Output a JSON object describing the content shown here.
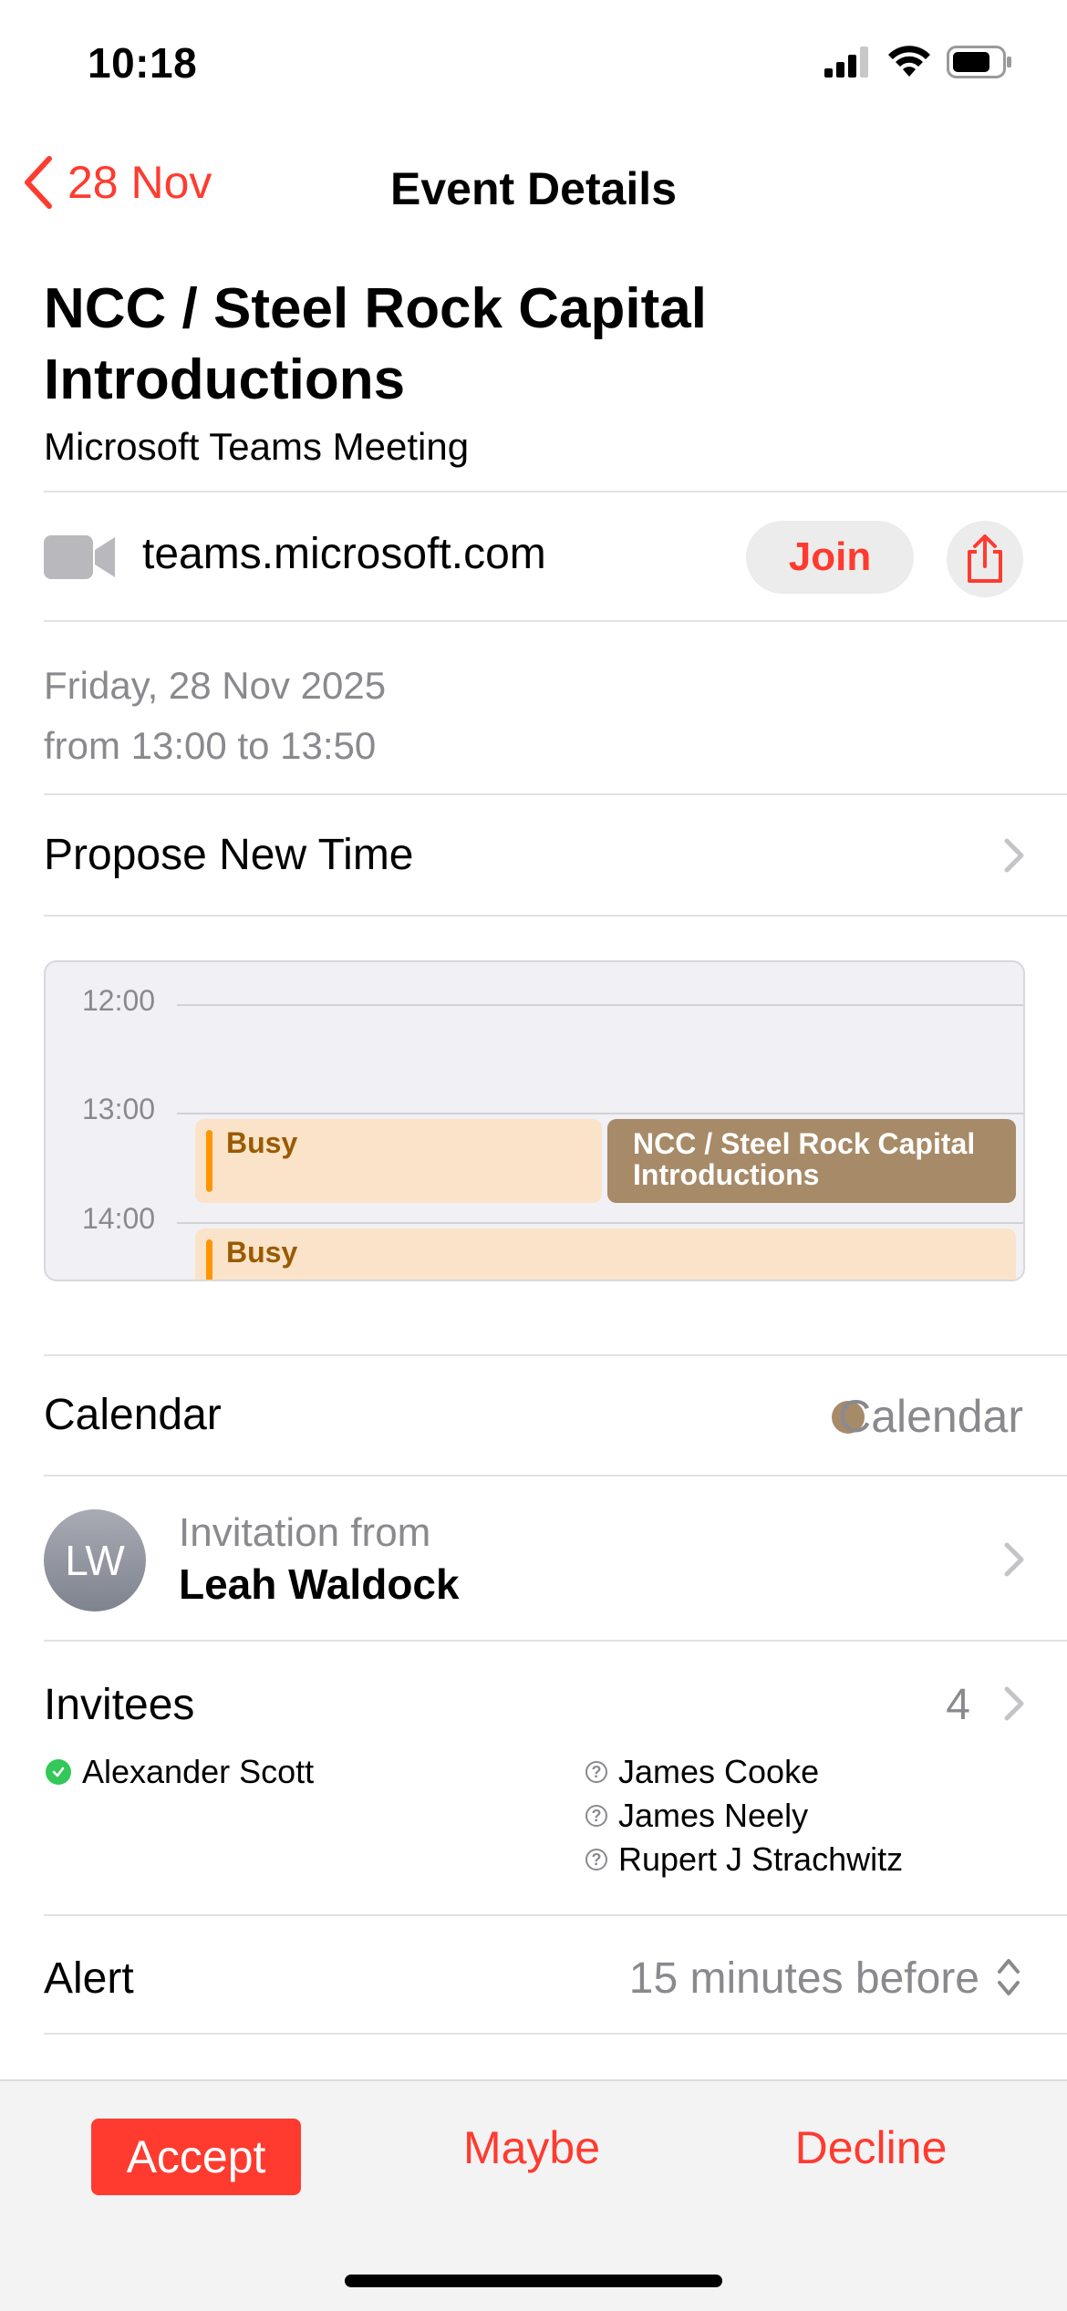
{
  "status_bar": {
    "time": "10:18"
  },
  "nav": {
    "back_label": "28 Nov",
    "title": "Event Details"
  },
  "event": {
    "title": "NCC / Steel Rock Capital Introductions",
    "subtitle": "Microsoft Teams Meeting",
    "url": "teams.microsoft.com",
    "join_label": "Join",
    "date": "Friday, 28 Nov 2025",
    "time": "from 13:00 to 13:50"
  },
  "propose_label": "Propose New Time",
  "timeline": {
    "hours": [
      "12:00",
      "13:00",
      "14:00"
    ],
    "busy_label": "Busy",
    "event_label": "NCC / Steel Rock Capital Introductions"
  },
  "calendar": {
    "label": "Calendar",
    "value": "Calendar",
    "color": "#a78a67"
  },
  "invitation": {
    "label": "Invitation from",
    "name": "Leah Waldock",
    "initials": "LW"
  },
  "invitees": {
    "label": "Invitees",
    "count": "4",
    "items": [
      {
        "name": "Alexander Scott",
        "status": "accepted"
      },
      {
        "name": "James Cooke",
        "status": "unknown"
      },
      {
        "name": "James Neely",
        "status": "unknown"
      },
      {
        "name": "Rupert J Strachwitz",
        "status": "unknown"
      }
    ]
  },
  "alert": {
    "label": "Alert",
    "value": "15 minutes before"
  },
  "actions": {
    "accept": "Accept",
    "maybe": "Maybe",
    "decline": "Decline"
  },
  "colors": {
    "accent": "#ff3b30",
    "busy_fill": "#fae3c8",
    "busy_bar": "#ff9500",
    "event_fill": "#a78a67",
    "accepted": "#34c759"
  }
}
